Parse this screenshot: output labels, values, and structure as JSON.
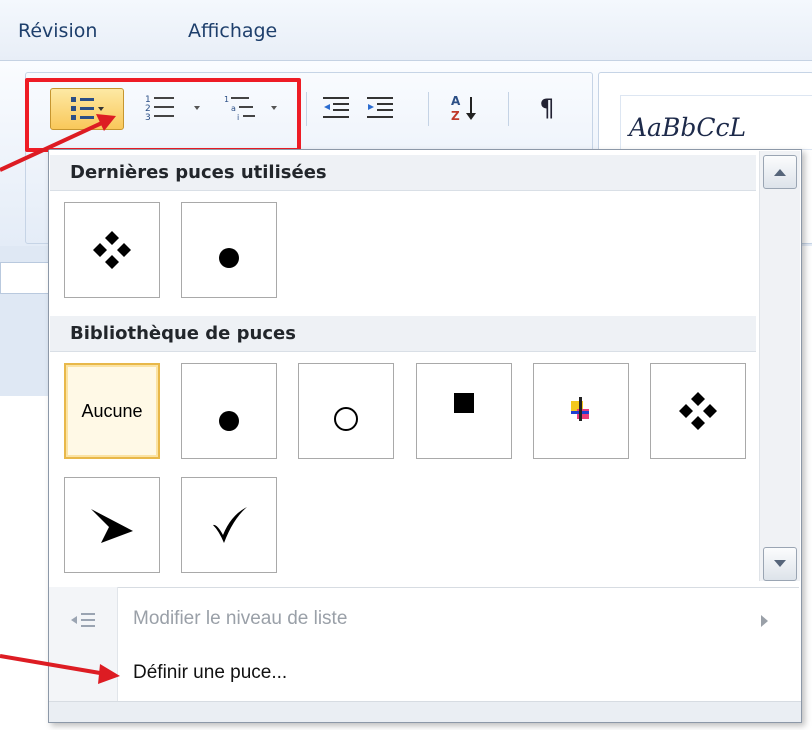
{
  "tabs": [
    "Révision",
    "Affichage"
  ],
  "style_sample": "AaBbCcL",
  "menu": {
    "recent_header": "Dernières puces utilisées",
    "library_header": "Bibliothèque de puces",
    "none_label": "Aucune",
    "change_level": "Modifier le niveau de liste",
    "define_bullet": "Définir une puce..."
  },
  "icons": {
    "recent": [
      "diamond-cluster-bullet",
      "filled-circle-bullet"
    ],
    "library_row1": [
      "none",
      "filled-circle-bullet",
      "hollow-circle-bullet",
      "filled-square-bullet",
      "colored-cross-bullet",
      "diamond-cluster-bullet"
    ],
    "library_row2": [
      "arrowhead-bullet",
      "checkmark-bullet"
    ]
  },
  "colors": {
    "highlight_box": "#ee1c25",
    "arrows": "#dd1c23",
    "selection": "#e8b84a"
  }
}
